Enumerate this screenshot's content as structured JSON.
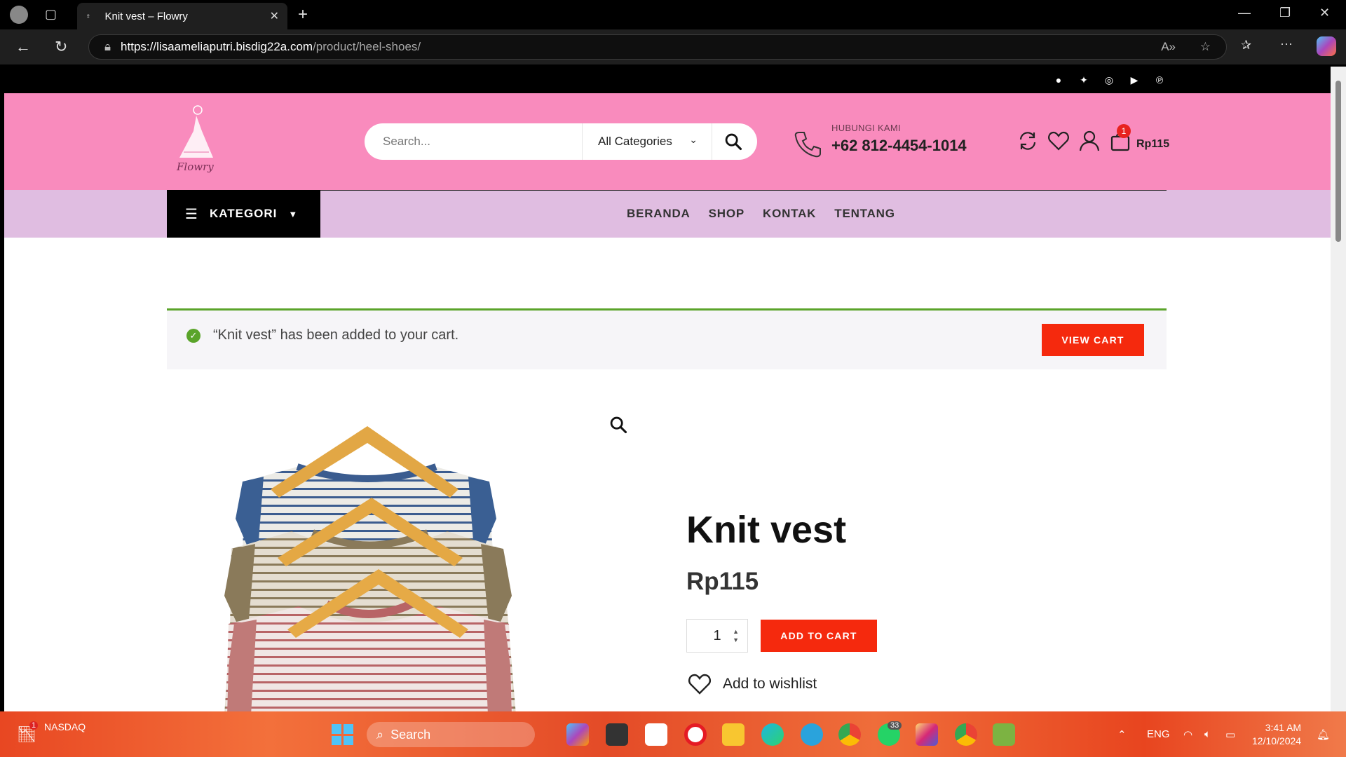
{
  "browser": {
    "tab_title": "Knit vest – Flowry",
    "url_host": "https://lisaameliaputri.bisdig22a.com",
    "url_path": "/product/heel-shoes/"
  },
  "header": {
    "search_placeholder": "Search...",
    "category_select": "All Categories",
    "contact_label": "HUBUNGI KAMI",
    "contact_phone": "+62 812-4454-1014",
    "cart_count": "1",
    "cart_total": "Rp115"
  },
  "nav": {
    "kategori": "KATEGORI",
    "items": [
      "BERANDA",
      "SHOP",
      "KONTAK",
      "TENTANG"
    ]
  },
  "notice": {
    "message": "“Knit vest” has been added to your cart.",
    "button": "VIEW CART"
  },
  "product": {
    "title": "Knit vest",
    "price": "Rp115",
    "quantity": "1",
    "add_to_cart": "ADD TO CART",
    "wishlist": "Add to wishlist"
  },
  "taskbar": {
    "widget_title": "NASDAQ",
    "widget_badge": "1",
    "search": "Search",
    "language": "ENG",
    "time": "3:41 AM",
    "date": "12/10/2024",
    "whatsapp_badge": "33"
  },
  "colors": {
    "header_pink": "#f98bbd",
    "nav_lilac": "#e0bde1",
    "accent_red": "#f5290d",
    "success_green": "#5aa42a"
  }
}
